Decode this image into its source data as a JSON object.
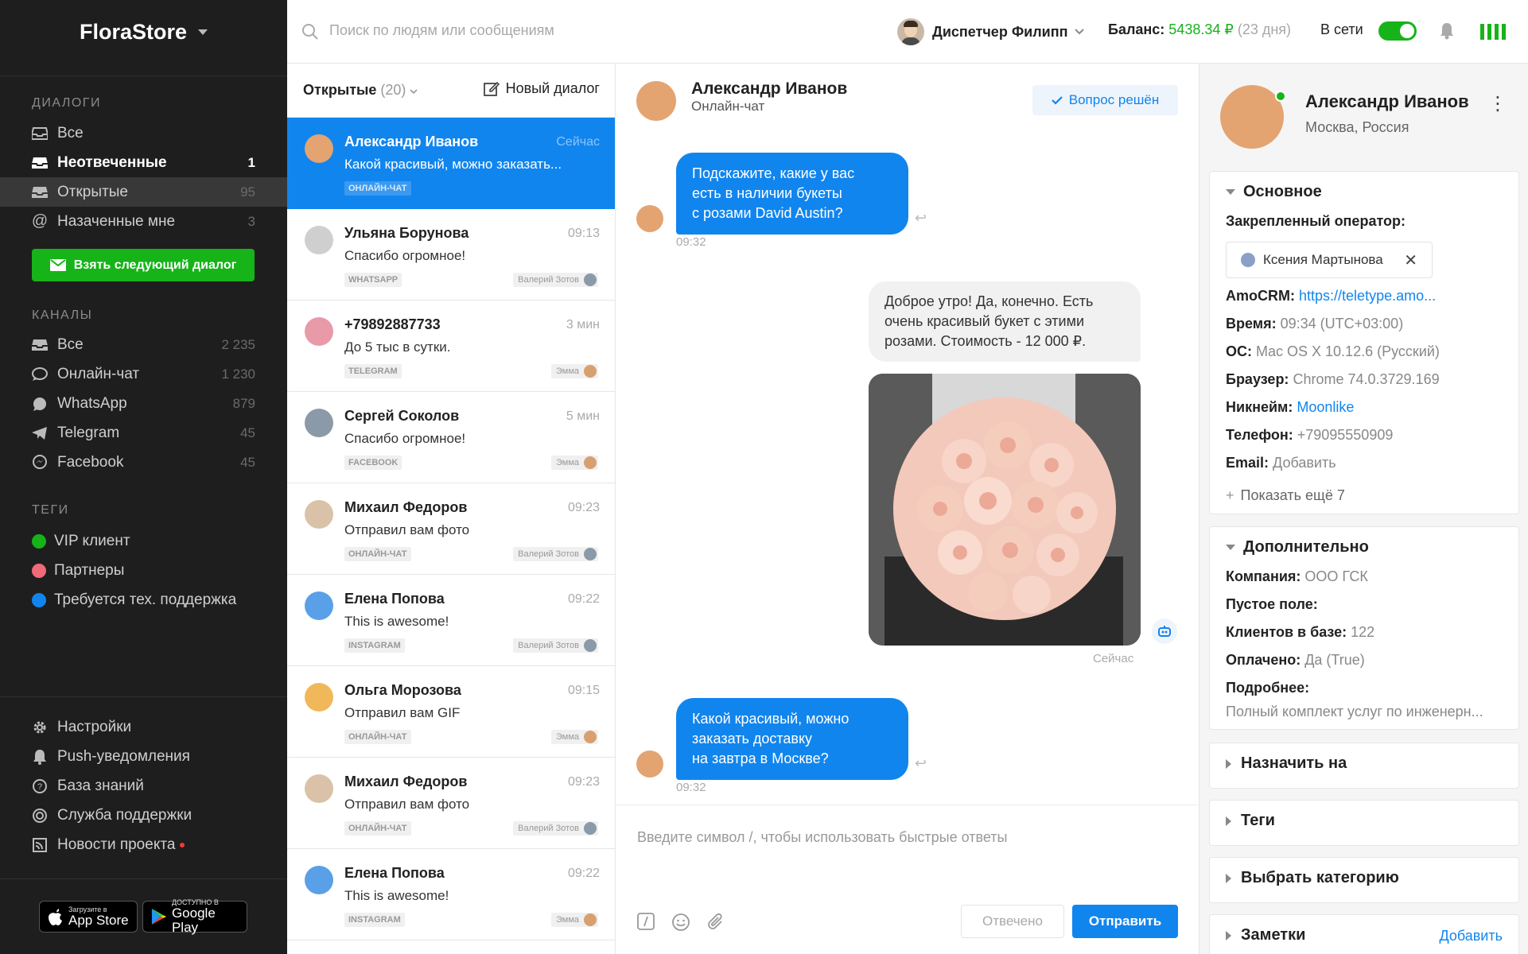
{
  "brand": {
    "title": "FloraStore"
  },
  "sidebar": {
    "dialogs_title": "ДИАЛОГИ",
    "dialogs": [
      {
        "label": "Все",
        "count": "",
        "icon": "inbox-icon"
      },
      {
        "label": "Неотвеченные",
        "count": "1",
        "icon": "inbox-icon"
      },
      {
        "label": "Открытые",
        "count": "95",
        "icon": "inbox-icon"
      },
      {
        "label": "Назаченные мне",
        "count": "3",
        "icon": "at-icon"
      }
    ],
    "take_next_label": "Взять следующий диалог",
    "channels_title": "КАНАЛЫ",
    "channels": [
      {
        "label": "Все",
        "count": "2 235",
        "icon": "inbox-icon"
      },
      {
        "label": "Онлайн-чат",
        "count": "1 230",
        "icon": "chat-icon"
      },
      {
        "label": "WhatsApp",
        "count": "879",
        "icon": "whatsapp-icon"
      },
      {
        "label": "Telegram",
        "count": "45",
        "icon": "telegram-icon"
      },
      {
        "label": "Facebook",
        "count": "45",
        "icon": "messenger-icon"
      }
    ],
    "tags_title": "ТЕГИ",
    "tags": [
      {
        "label": "VIP клиент",
        "color": "#16b319"
      },
      {
        "label": "Партнеры",
        "color": "#f06a7a"
      },
      {
        "label": "Требуется тех. поддержка",
        "color": "#1185ee"
      }
    ],
    "bottom": [
      {
        "label": "Настройки",
        "icon": "gear-icon"
      },
      {
        "label": "Push-уведомления",
        "icon": "bell-icon"
      },
      {
        "label": "База знаний",
        "icon": "help-icon"
      },
      {
        "label": "Служба поддержки",
        "icon": "lifebuoy-icon"
      },
      {
        "label": "Новости проекта",
        "icon": "rss-icon"
      }
    ],
    "appstore": {
      "small": "Загрузите в",
      "big": "App Store"
    },
    "googleplay": {
      "small": "ДОСТУПНО В",
      "big": "Google Play"
    }
  },
  "topbar": {
    "search_placeholder": "Поиск по людям или сообщениям",
    "agent_name": "Диспетчер Филипп",
    "balance_label": "Баланс:",
    "balance_value": "5438.34 ₽",
    "balance_days": "(23 дня)",
    "online_label": "В сети"
  },
  "dialog_list": {
    "filter_label": "Открытые",
    "filter_count": "(20)",
    "new_dialog_label": "Новый диалог",
    "items": [
      {
        "name": "Александр Иванов",
        "time": "Сейчас",
        "message": "Какой красивый, можно заказать...",
        "channel": "ОНЛАЙН-ЧАТ",
        "assignee": "",
        "avatar_color": "#e3a472"
      },
      {
        "name": "Ульяна Борунова",
        "time": "09:13",
        "message": "Спасибо огромное!",
        "channel": "WHATSAPP",
        "assignee": "Валерий Зотов",
        "avatar_color": "#cfcfcf"
      },
      {
        "name": "+79892887733",
        "time": "3 мин",
        "message": "До 5 тыс в сутки.",
        "channel": "TELEGRAM",
        "assignee": "Эмма",
        "avatar_color": "#e89aa8"
      },
      {
        "name": "Сергей Соколов",
        "time": "5 мин",
        "message": "Спасибо огромное!",
        "channel": "FACEBOOK",
        "assignee": "Эмма",
        "avatar_color": "#8a9aa8"
      },
      {
        "name": "Михаил Федоров",
        "time": "09:23",
        "message": "Отправил вам фото",
        "channel": "ОНЛАЙН-ЧАТ",
        "assignee": "Валерий Зотов",
        "avatar_color": "#d9c2a8"
      },
      {
        "name": "Елена Попова",
        "time": "09:22",
        "message": "This is awesome!",
        "channel": "INSTAGRAM",
        "assignee": "Валерий Зотов",
        "avatar_color": "#5aa0e8"
      },
      {
        "name": "Ольга Морозова",
        "time": "09:15",
        "message": "Отправил вам GIF",
        "channel": "ОНЛАЙН-ЧАТ",
        "assignee": "Эмма",
        "avatar_color": "#f0b85a"
      },
      {
        "name": "Михаил Федоров",
        "time": "09:23",
        "message": "Отправил вам фото",
        "channel": "ОНЛАЙН-ЧАТ",
        "assignee": "Валерий Зотов",
        "avatar_color": "#d9c2a8"
      },
      {
        "name": "Елена Попова",
        "time": "09:22",
        "message": "This is awesome!",
        "channel": "INSTAGRAM",
        "assignee": "Эмма",
        "avatar_color": "#5aa0e8"
      }
    ]
  },
  "chat": {
    "name": "Александр Иванов",
    "channel": "Онлайн-чат",
    "resolved_label": "Вопрос решён",
    "messages": [
      {
        "dir": "in",
        "lines": [
          "Подскажите, какие у вас",
          "есть в наличии букеты",
          "с розами David Austin?"
        ],
        "time": "09:32"
      },
      {
        "dir": "out",
        "lines": [
          "Доброе утро! Да, конечно. Есть",
          "очень красивый букет с этими",
          "розами. Стоимость - 12 000 ₽."
        ]
      },
      {
        "dir": "out-photo",
        "time": "Сейчас"
      },
      {
        "dir": "in",
        "lines": [
          "Какой красивый, можно",
          "заказать доставку",
          "на завтра в Москве?"
        ],
        "time": "09:32"
      }
    ],
    "composer_placeholder": "Введите символ /, чтобы использовать быстрые ответы",
    "done_label": "Отвечено",
    "send_label": "Отправить"
  },
  "profile": {
    "name": "Александр Иванов",
    "location": "Москва, Россия",
    "main_title": "Основное",
    "operator_label": "Закрепленный оператор:",
    "operator_name": "Ксения Мартынова",
    "fields": [
      {
        "label": "AmoCRM:",
        "value": "https://teletype.amo...",
        "link": true
      },
      {
        "label": "Время:",
        "value": "09:34 (UTC+03:00)",
        "link": false
      },
      {
        "label": "ОС:",
        "value": "Mac OS X 10.12.6 (Русский)",
        "link": false
      },
      {
        "label": "Браузер:",
        "value": "Chrome 74.0.3729.169",
        "link": false
      },
      {
        "label": "Никнейм:",
        "value": "Moonlike",
        "link": true
      },
      {
        "label": "Телефон:",
        "value": "+79095550909",
        "link": false
      },
      {
        "label": "Email:",
        "value": "Добавить",
        "link": false
      }
    ],
    "show_more": "Показать ещё 7",
    "extra_title": "Дополнительно",
    "extra_fields": [
      {
        "label": "Компания:",
        "value": "ООО ГСК"
      },
      {
        "label": "Пустое поле:",
        "value": ""
      },
      {
        "label": "Клиентов в базе:",
        "value": "122"
      },
      {
        "label": "Оплачено:",
        "value": "Да (True)"
      },
      {
        "label": "Подробнее:",
        "value": ""
      }
    ],
    "extra_details": "Полный комплект услуг по инженерн...",
    "assign_title": "Назначить на",
    "tags_title": "Теги",
    "category_title": "Выбрать категорию",
    "notes_title": "Заметки",
    "notes_add": "Добавить"
  }
}
